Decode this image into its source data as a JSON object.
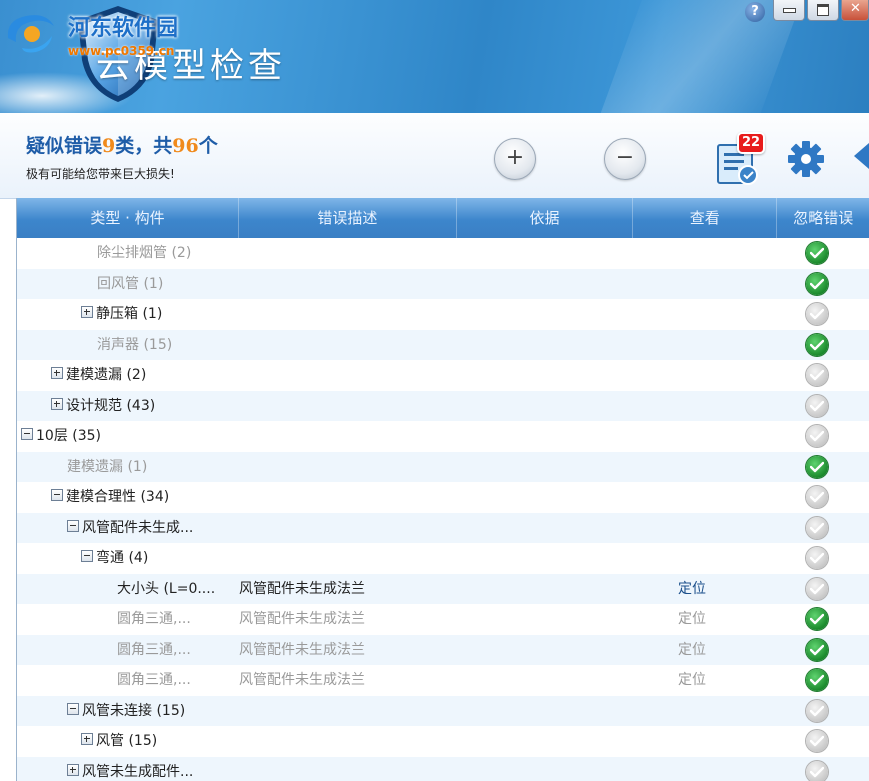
{
  "watermark": {
    "name": "河东软件园",
    "url": "www.pc0359.cn"
  },
  "app": {
    "title": "云模型检查"
  },
  "window": {
    "help": "?",
    "close": "✕"
  },
  "summary": {
    "prefix": "疑似错误",
    "category_count": "9",
    "middle": "类，共",
    "total_count": "96",
    "suffix": "个",
    "subtitle": "极有可能给您带来巨大损失!"
  },
  "toolbar": {
    "expand_label": "+",
    "collapse_label": "−",
    "report_badge": "22"
  },
  "colors": {
    "header_blue": "#3d86cc",
    "accent_orange": "#f08a1c",
    "ok_green": "#1b8a2c",
    "badge_red": "#e81c1c"
  },
  "columns": [
    "类型 · 构件",
    "错误描述",
    "依据",
    "查看",
    "忽略错误"
  ],
  "rows": [
    {
      "label": "除尘排烟管 (2)",
      "indent": 80,
      "toggle": "",
      "grey": true,
      "desc": "",
      "loc": "",
      "ignored": true
    },
    {
      "label": "回风管 (1)",
      "indent": 80,
      "toggle": "",
      "grey": true,
      "desc": "",
      "loc": "",
      "ignored": true
    },
    {
      "label": "静压箱 (1)",
      "indent": 64,
      "toggle": "plus",
      "grey": false,
      "desc": "",
      "loc": "",
      "ignored": false
    },
    {
      "label": "消声器 (15)",
      "indent": 80,
      "toggle": "",
      "grey": true,
      "desc": "",
      "loc": "",
      "ignored": true
    },
    {
      "label": "建模遗漏 (2)",
      "indent": 34,
      "toggle": "plus",
      "grey": false,
      "desc": "",
      "loc": "",
      "ignored": false
    },
    {
      "label": "设计规范 (43)",
      "indent": 34,
      "toggle": "plus",
      "grey": false,
      "desc": "",
      "loc": "",
      "ignored": false
    },
    {
      "label": "10层 (35)",
      "indent": 4,
      "toggle": "minus",
      "grey": false,
      "desc": "",
      "loc": "",
      "ignored": false
    },
    {
      "label": "建模遗漏 (1)",
      "indent": 50,
      "toggle": "",
      "grey": true,
      "desc": "",
      "loc": "",
      "ignored": true
    },
    {
      "label": "建模合理性 (34)",
      "indent": 34,
      "toggle": "minus",
      "grey": false,
      "desc": "",
      "loc": "",
      "ignored": false
    },
    {
      "label": "风管配件未生成...",
      "indent": 50,
      "toggle": "minus",
      "grey": false,
      "desc": "",
      "loc": "",
      "ignored": false
    },
    {
      "label": "弯通 (4)",
      "indent": 64,
      "toggle": "minus",
      "grey": false,
      "desc": "",
      "loc": "",
      "ignored": false
    },
    {
      "label": "大小头 (L=0....",
      "indent": 100,
      "toggle": "",
      "grey": false,
      "desc": "风管配件未生成法兰",
      "loc": "定位",
      "ignored": false
    },
    {
      "label": "圆角三通,...",
      "indent": 100,
      "toggle": "",
      "grey": true,
      "desc": "风管配件未生成法兰",
      "loc": "定位",
      "ignored": true
    },
    {
      "label": "圆角三通,...",
      "indent": 100,
      "toggle": "",
      "grey": true,
      "desc": "风管配件未生成法兰",
      "loc": "定位",
      "ignored": true
    },
    {
      "label": "圆角三通,...",
      "indent": 100,
      "toggle": "",
      "grey": true,
      "desc": "风管配件未生成法兰",
      "loc": "定位",
      "ignored": true
    },
    {
      "label": "风管未连接 (15)",
      "indent": 50,
      "toggle": "minus",
      "grey": false,
      "desc": "",
      "loc": "",
      "ignored": false
    },
    {
      "label": "风管 (15)",
      "indent": 64,
      "toggle": "plus",
      "grey": false,
      "desc": "",
      "loc": "",
      "ignored": false
    },
    {
      "label": "风管未生成配件...",
      "indent": 50,
      "toggle": "plus",
      "grey": false,
      "desc": "",
      "loc": "",
      "ignored": false
    }
  ]
}
